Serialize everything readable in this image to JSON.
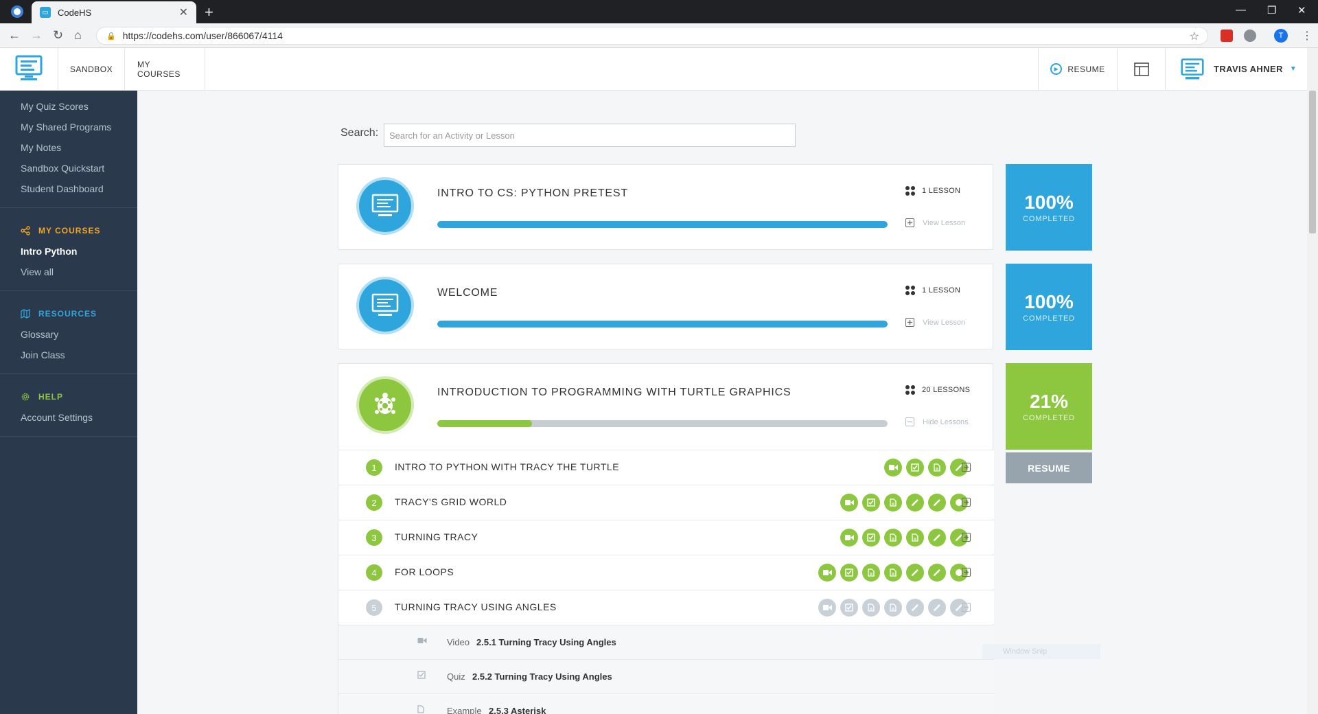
{
  "browser": {
    "tab_title": "CodeHS",
    "tab_close": "✕",
    "new_tab": "+",
    "url": "https://codehs.com/user/866067/4114",
    "profile_initial": "T"
  },
  "header": {
    "nav": [
      "SANDBOX",
      "MY COURSES"
    ],
    "resume": "RESUME",
    "user_name": "TRAVIS AHNER"
  },
  "sidebar": {
    "items_top": [
      "My Quiz Scores",
      "My Shared Programs",
      "My Notes",
      "Sandbox Quickstart",
      "Student Dashboard"
    ],
    "my_courses": {
      "heading": "MY COURSES",
      "items": [
        "Intro Python",
        "View all"
      ]
    },
    "resources": {
      "heading": "RESOURCES",
      "items": [
        "Glossary",
        "Join Class"
      ]
    },
    "help": {
      "heading": "HELP",
      "items": [
        "Account Settings"
      ]
    },
    "colors": {
      "my_courses": "#f5a623",
      "resources": "#2ea5dd",
      "help": "#8dc63f"
    }
  },
  "search": {
    "label": "Search:",
    "placeholder": "Search for an Activity or Lesson"
  },
  "units": [
    {
      "title": "INTRO TO CS: PYTHON PRETEST",
      "lessons": "1 LESSON",
      "toggle": "View Lesson",
      "progress": 1.0,
      "percent": "100%",
      "percent_label": "COMPLETED",
      "color": "#2ea5dd"
    },
    {
      "title": "WELCOME",
      "lessons": "1 LESSON",
      "toggle": "View Lesson",
      "progress": 1.0,
      "percent": "100%",
      "percent_label": "COMPLETED",
      "color": "#2ea5dd"
    },
    {
      "title": "INTRODUCTION TO PROGRAMMING WITH TURTLE GRAPHICS",
      "lessons": "20 LESSONS",
      "toggle": "Hide Lessons",
      "progress": 0.21,
      "percent": "21%",
      "percent_label": "COMPLETED",
      "color": "#8dc63f"
    }
  ],
  "resume_button": "RESUME",
  "lessons": [
    {
      "num": "1",
      "title": "INTRO TO PYTHON WITH TRACY THE TURTLE",
      "icons": [
        "video",
        "quiz",
        "doc",
        "pencil"
      ],
      "done": true
    },
    {
      "num": "2",
      "title": "TRACY'S GRID WORLD",
      "icons": [
        "video",
        "quiz",
        "doc",
        "pencil",
        "pencil",
        "circle"
      ],
      "done": true
    },
    {
      "num": "3",
      "title": "TURNING TRACY",
      "icons": [
        "video",
        "quiz",
        "doc",
        "doc",
        "pencil",
        "pencil"
      ],
      "done": true
    },
    {
      "num": "4",
      "title": "FOR LOOPS",
      "icons": [
        "video",
        "quiz",
        "doc",
        "doc",
        "pencil",
        "pencil",
        "circle"
      ],
      "done": true
    },
    {
      "num": "5",
      "title": "TURNING TRACY USING ANGLES",
      "icons": [
        "video",
        "quiz",
        "doc",
        "doc",
        "pencil",
        "pencil",
        "pencil"
      ],
      "done": false
    }
  ],
  "activities": [
    {
      "type": "Video",
      "name": "2.5.1 Turning Tracy Using Angles",
      "icon": "video-icon"
    },
    {
      "type": "Quiz",
      "name": "2.5.2 Turning Tracy Using Angles",
      "icon": "quiz-icon"
    },
    {
      "type": "Example",
      "name": "2.5.3 Asterisk",
      "icon": "document-icon"
    }
  ],
  "overlay": {
    "window_snip": "Window Snip"
  }
}
